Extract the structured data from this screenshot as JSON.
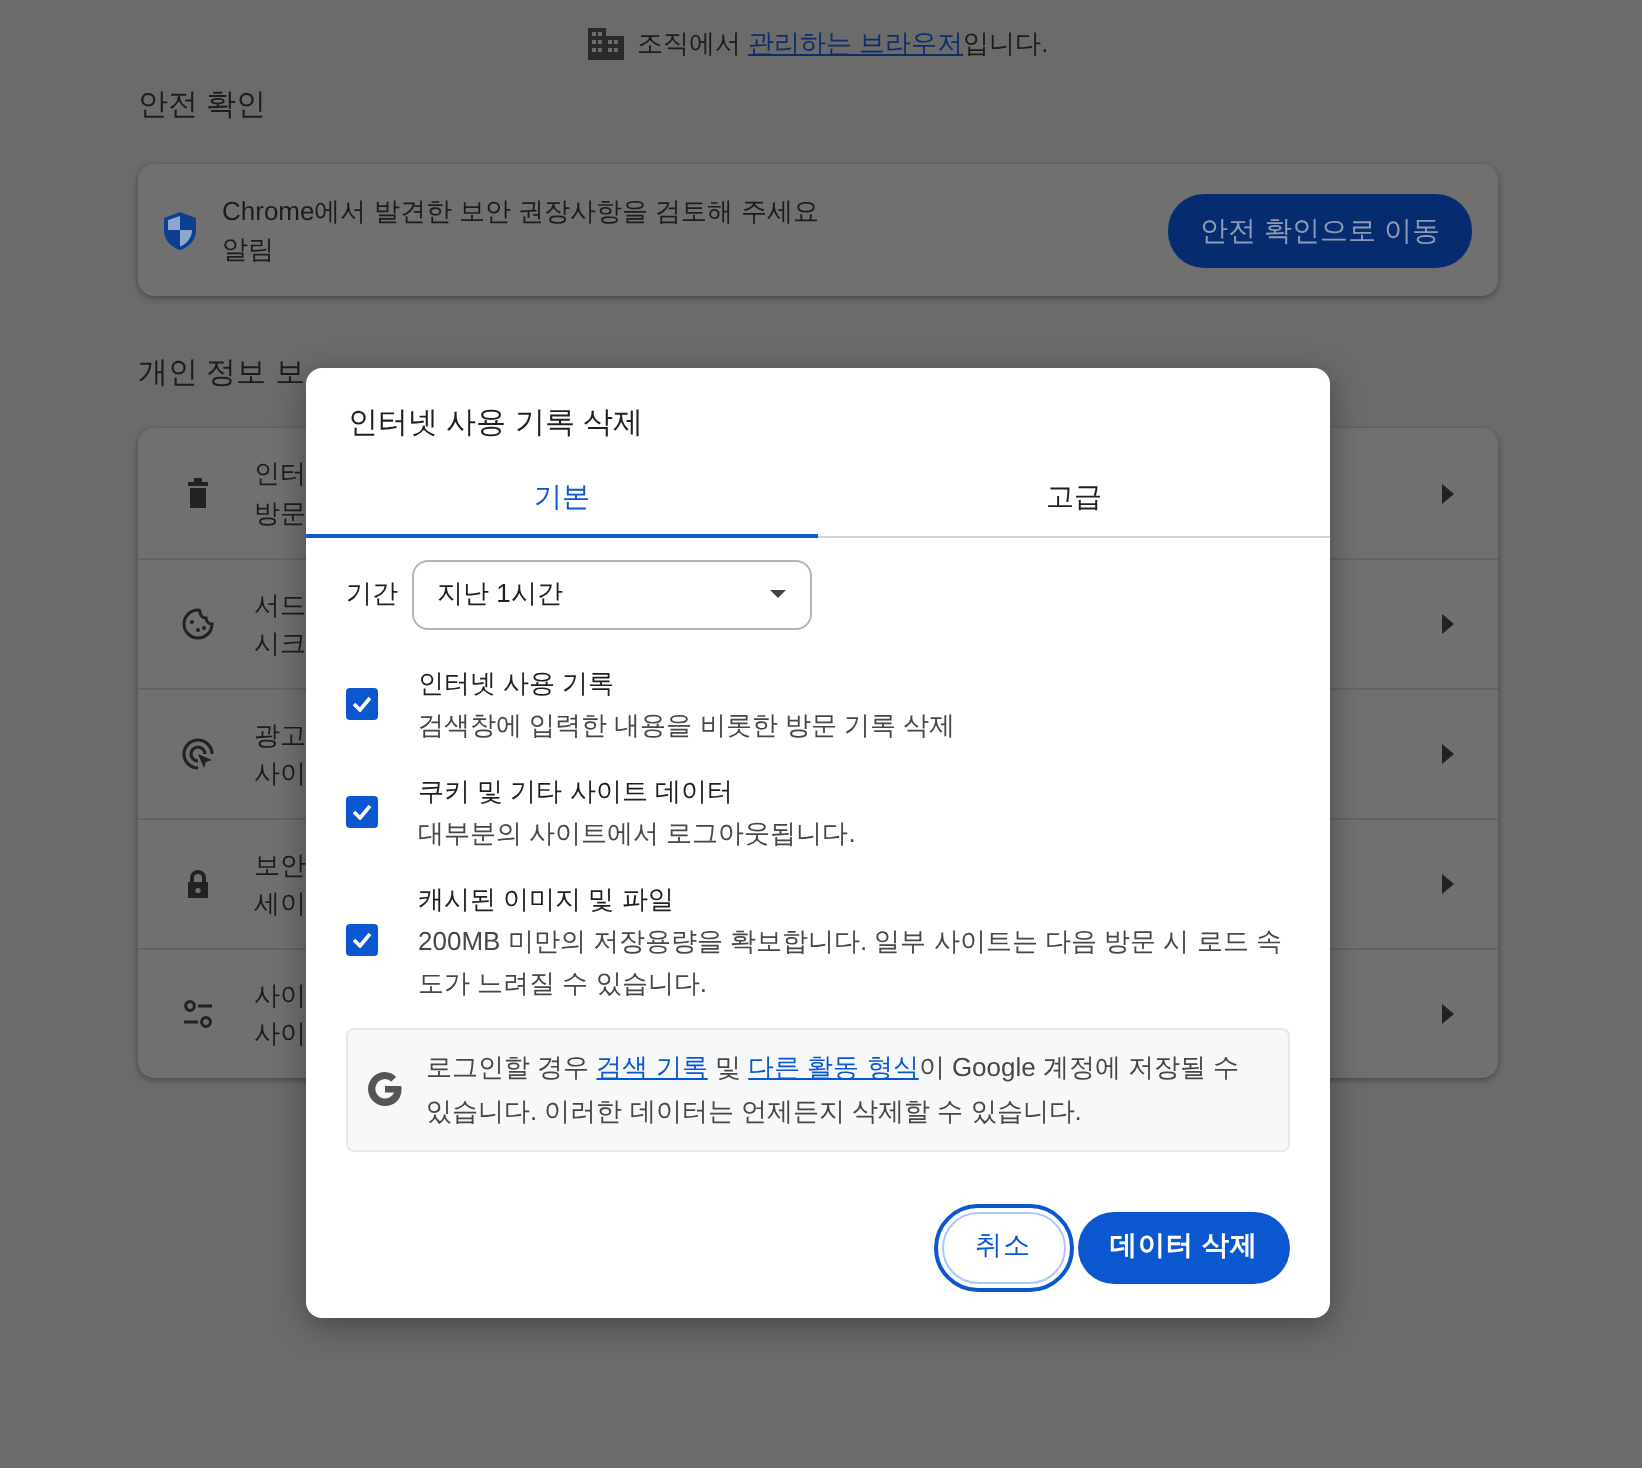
{
  "banner": {
    "parts": [
      {
        "kind": "text",
        "text": "조직에서 "
      },
      {
        "kind": "link",
        "text": "관리하는 브라우저"
      },
      {
        "kind": "text",
        "text": "입니다."
      }
    ]
  },
  "safety_check": {
    "heading": "안전 확인",
    "title": "Chrome에서 발견한 보안 권장사항을 검토해 주세요",
    "subtitle": "알림",
    "button": "안전 확인으로 이동"
  },
  "privacy": {
    "heading": "개인 정보 보",
    "rows": [
      {
        "kind": "trash",
        "title": "인터",
        "subtitle": "방문"
      },
      {
        "kind": "cookie",
        "title": "서드",
        "subtitle": "시크"
      },
      {
        "kind": "ads",
        "title": "광고",
        "subtitle": "사이"
      },
      {
        "kind": "lock",
        "title": "보안",
        "subtitle": "세이"
      },
      {
        "kind": "tune",
        "title": "사이",
        "subtitle": "사이"
      }
    ]
  },
  "dialog": {
    "title": "인터넷 사용 기록 삭제",
    "tabs": [
      {
        "label": "기본",
        "selected": true
      },
      {
        "label": "고급",
        "selected": false
      }
    ],
    "time_range": {
      "label": "기간",
      "value": "지난 1시간"
    },
    "options": [
      {
        "title": "인터넷 사용 기록",
        "description": "검색창에 입력한 내용을 비롯한 방문 기록 삭제",
        "checked": true
      },
      {
        "title": "쿠키 및 기타 사이트 데이터",
        "description": "대부분의 사이트에서 로그아웃됩니다.",
        "checked": true
      },
      {
        "title": "캐시된 이미지 및 파일",
        "description": "200MB 미만의 저장용량을 확보합니다. 일부 사이트는 다음 방문 시 로드 속도가 느려질 수 있습니다.",
        "checked": true
      }
    ],
    "notice": {
      "parts": [
        {
          "kind": "text",
          "text": "로그인할 경우 "
        },
        {
          "kind": "link",
          "text": "검색 기록"
        },
        {
          "kind": "text",
          "text": " 및 "
        },
        {
          "kind": "link",
          "text": "다른 활동 형식"
        },
        {
          "kind": "text",
          "text": "이 Google 계정에 저장될 수 있습니다. 이러한 데이터는 언제든지 삭제할 수 있습니다."
        }
      ]
    },
    "buttons": [
      {
        "label": "취소",
        "kind": "secondary",
        "focused": true
      },
      {
        "label": "데이터 삭제",
        "kind": "primary",
        "focused": false
      }
    ]
  }
}
